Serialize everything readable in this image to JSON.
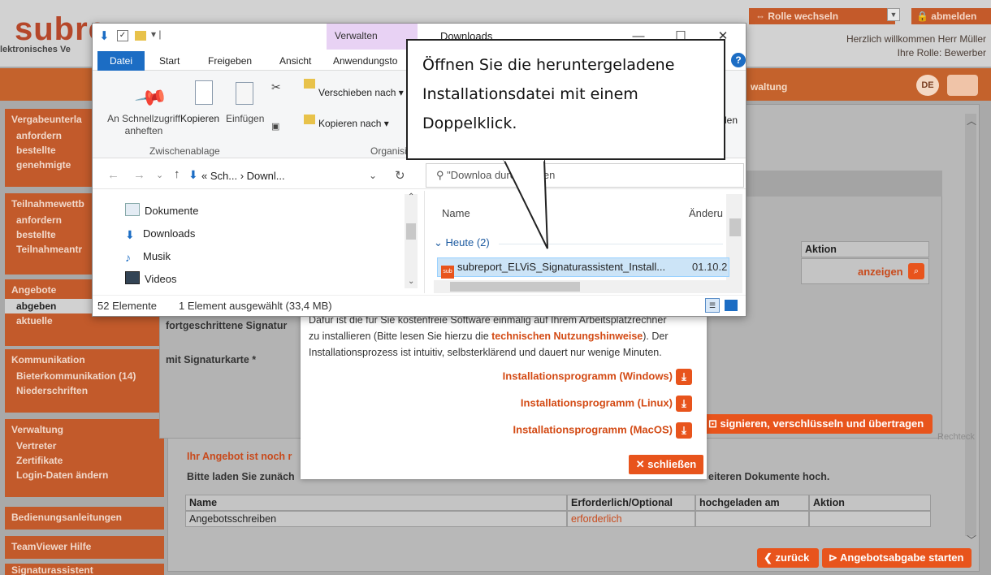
{
  "header": {
    "logo": "subre",
    "logo_sub": "lektronisches Ve",
    "rolle_wechseln": "⇔ Rolle wechseln",
    "abmelden": "abmelden",
    "welcome": "Herzlich willkommen Herr Müller",
    "role": "Ihre Rolle: Bewerber",
    "verwaltung_tab": "waltung",
    "language": "DE"
  },
  "sidebar": {
    "groups": [
      {
        "title": "Vergabeunterla",
        "items": [
          "anfordern",
          "bestellte",
          "genehmigte"
        ]
      },
      {
        "title": "Teilnahmewettb",
        "items": [
          "anfordern",
          "bestellte",
          "Teilnahmeantr"
        ]
      },
      {
        "title": "Angebote",
        "items": [
          "abgeben",
          "aktuelle"
        ]
      },
      {
        "title": "Kommunikation",
        "items": [
          "Bieterkommunikation (14)",
          "Niederschriften"
        ]
      },
      {
        "title": "Verwaltung",
        "items": [
          "Vertreter",
          "Zertifikate",
          "Login-Daten ändern"
        ]
      }
    ],
    "bedienungsanleitungen": "Bedienungsanleitungen",
    "teamviewer": "TeamViewer Hilfe",
    "signaturassistent": "Signaturassistent"
  },
  "main": {
    "aktion_header": "Aktion",
    "anzeigen": "anzeigen",
    "fortgeschrittene": "fortgeschrittene Signatur",
    "mit_signaturkarte": "mit Signaturkarte *",
    "signieren_btn": "signieren, verschlüsseln und übertragen",
    "rechteck": "Rechteck",
    "angebot_warning": "Ihr Angebot ist noch r",
    "bitte_laden": "Bitte laden Sie zunäch",
    "weiteren_dokumente": "eiteren Dokumente hoch.",
    "table_headers": [
      "Name",
      "Erforderlich/Optional",
      "hochgeladen am",
      "Aktion"
    ],
    "table_rows": [
      [
        "Angebotsschreiben",
        "erforderlich",
        "",
        ""
      ]
    ],
    "zurueck": "zurück",
    "angebotsabgabe": "Angebotsabgabe starten"
  },
  "install_dialog": {
    "text_1": "Dafür ist die für Sie kostenfreie Software einmalig auf Ihrem Arbeitsplatzrechner",
    "text_2a": "zu installieren (Bitte lesen Sie hierzu die ",
    "text_2_link": "technischen Nutzungshinweise",
    "text_2b": "). Der",
    "text_3": "Installationsprozess ist intuitiv, selbsterklärend und dauert nur wenige Minuten.",
    "btn_windows": "Installationsprogramm (Windows)",
    "btn_linux": "Installationsprogramm (Linux)",
    "btn_macos": "Installationsprogramm (MacOS)",
    "close": "schließen"
  },
  "explorer": {
    "verwalten": "Verwalten",
    "title": "Downloads",
    "tabs": [
      "Datei",
      "Start",
      "Freigeben",
      "Ansicht",
      "Anwendungsto"
    ],
    "ribbon": {
      "schnellzugriff": "An Schnellzugriff anheften",
      "kopieren": "Kopieren",
      "einfuegen": "Einfügen",
      "zwischenablage": "Zwischenablage",
      "verschieben": "Verschieben nach",
      "kopieren_nach": "Kopieren nach",
      "organisieren": "Organisi",
      "len": "len"
    },
    "address": "« Sch...  ›  Downl...",
    "search_placeholder": "\"Downloa    durchsuchen",
    "nav_items": [
      "Dokumente",
      "Downloads",
      "Musik",
      "Videos"
    ],
    "col_name": "Name",
    "col_date": "Änderu",
    "group": "Heute (2)",
    "file_name": "subreport_ELViS_Signaturassistent_Install...",
    "file_date": "01.10.2",
    "status_count": "52 Elemente",
    "status_selected": "1 Element ausgewählt (33,4 MB)"
  },
  "callout": {
    "line1": "Öffnen Sie die heruntergeladene",
    "line2": "Installationsdatei mit einem",
    "line3": "Doppelklick."
  }
}
